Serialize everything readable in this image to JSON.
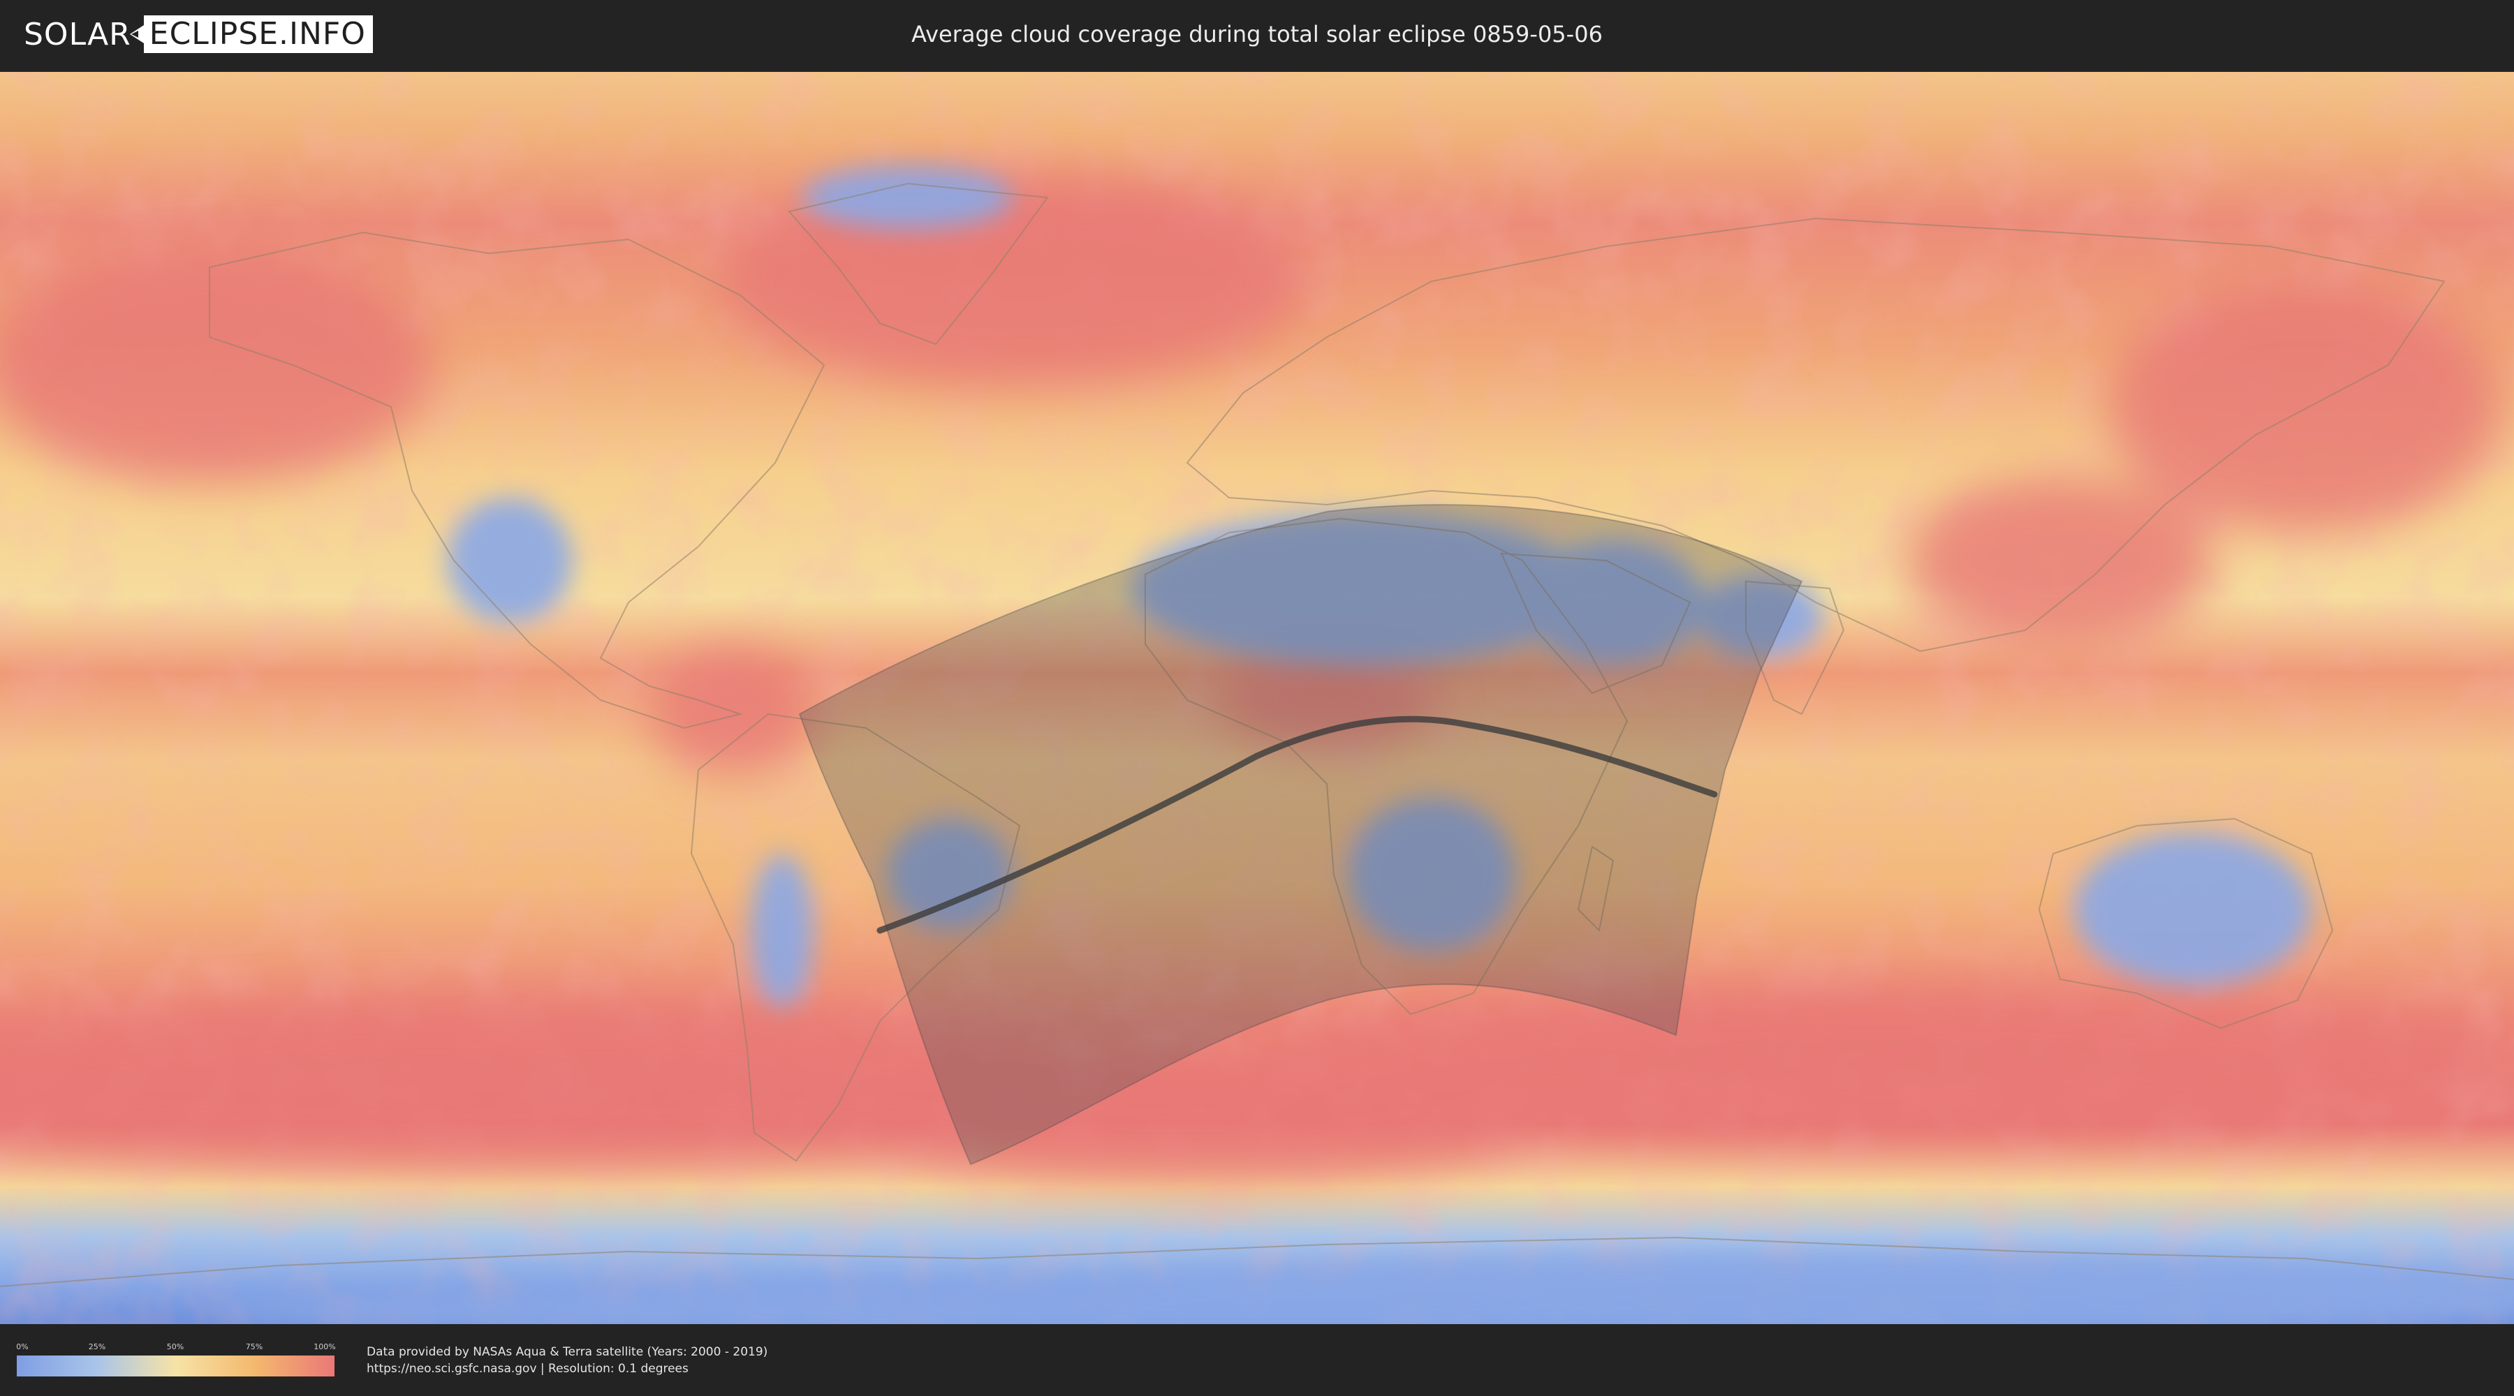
{
  "logo": {
    "left_text": "SOLAR",
    "boxed_text": "ECLIPSE.INFO"
  },
  "title": "Average cloud coverage during total solar eclipse 0859-05-06",
  "legend": {
    "ticks": [
      "0%",
      "25%",
      "50%",
      "75%",
      "100%"
    ],
    "colors": [
      "#7f9ee4",
      "#a9c4e9",
      "#f6e3a6",
      "#f4b86e",
      "#ea7877"
    ]
  },
  "credits": {
    "line1": "Data provided by NASAs Aqua & Terra satellite (Years: 2000 - 2019)",
    "line2": "https://neo.sci.gsfc.nasa.gov | Resolution: 0.1 degrees"
  },
  "map": {
    "projection": "equirectangular",
    "cloud_colors": {
      "clear": "#7f9ee4",
      "low": "#a9c4e9",
      "medium": "#f6e3a6",
      "high": "#f4b86e",
      "overcast": "#ea7877"
    },
    "eclipse_overlay_color": "#505050",
    "central_line_color": "#3c3c3c"
  }
}
